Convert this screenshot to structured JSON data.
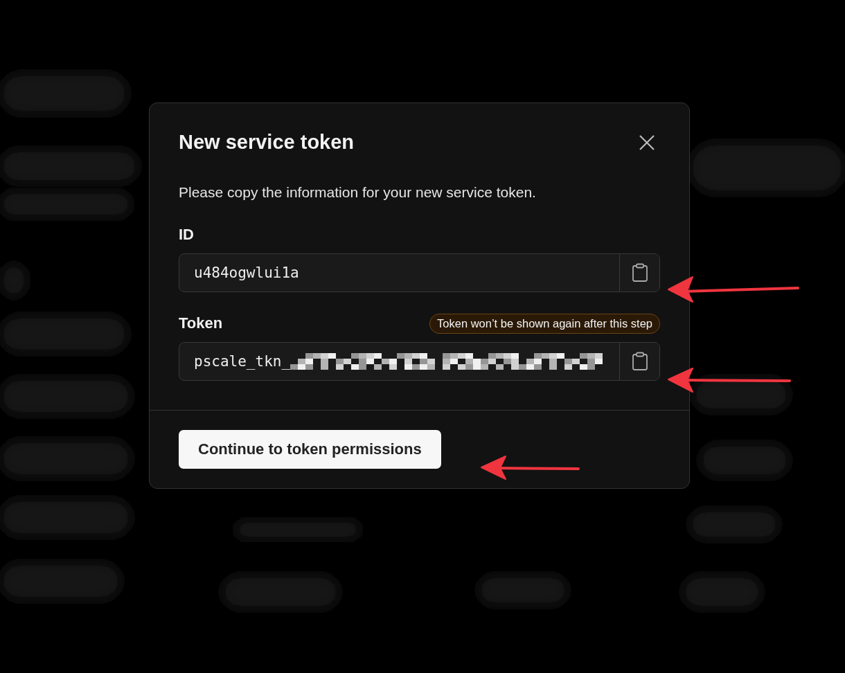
{
  "dialog": {
    "title": "New service token",
    "description": "Please copy the information for your new service token.",
    "fields": [
      {
        "label": "ID",
        "value": "u484ogwlui1a",
        "redacted": false
      },
      {
        "label": "Token",
        "badge": "Token won’t be shown again after this step",
        "value": "pscale_tkn_",
        "redacted": true
      }
    ],
    "button": "Continue to token permissions"
  }
}
